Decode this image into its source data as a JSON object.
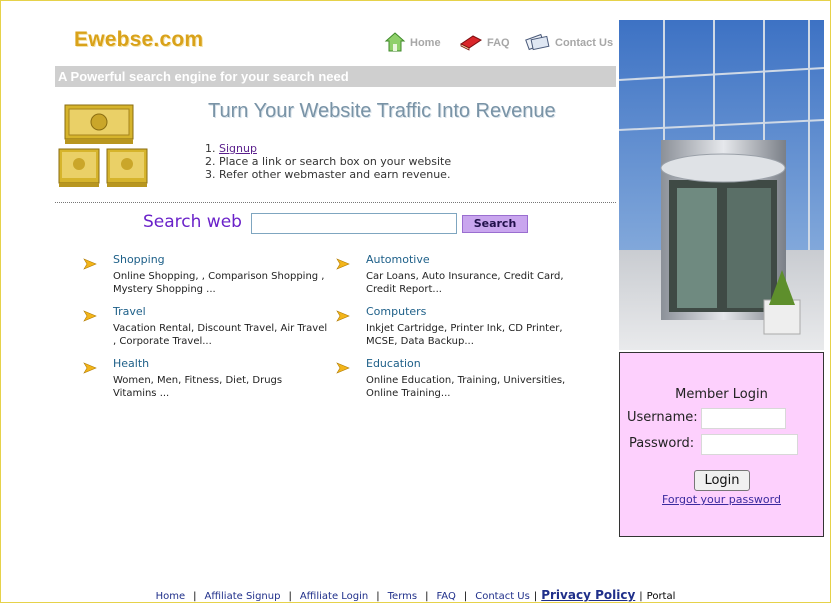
{
  "header": {
    "logo": "Ewebse.com",
    "nav": [
      {
        "label": "Home",
        "icon": "home-icon"
      },
      {
        "label": "FAQ",
        "icon": "book-icon"
      },
      {
        "label": "Contact Us",
        "icon": "cards-icon"
      }
    ],
    "tagline": "A Powerful search engine for your search need"
  },
  "promo": {
    "headline": "Turn Your Website Traffic Into Revenue",
    "steps": [
      {
        "prefix": "1. ",
        "text": "Signup"
      },
      {
        "prefix": "2. ",
        "text": "Place a link or search box on your website"
      },
      {
        "prefix": "3. ",
        "text": "Refer other webmaster and earn revenue."
      }
    ]
  },
  "search": {
    "label": "Search web",
    "button": "Search",
    "value": ""
  },
  "categories": [
    {
      "title": "Shopping",
      "desc": "Online Shopping, , Comparison Shopping , Mystery Shopping ..."
    },
    {
      "title": "Automotive",
      "desc": "Car Loans, Auto Insurance, Credit Card, Credit Report..."
    },
    {
      "title": "Travel",
      "desc": "Vacation Rental, Discount Travel, Air Travel , Corporate Travel..."
    },
    {
      "title": "Computers",
      "desc": "Inkjet Cartridge, Printer Ink, CD Printer, MCSE, Data Backup..."
    },
    {
      "title": "Health",
      "desc": "Women, Men, Fitness, Diet, Drugs Vitamins ..."
    },
    {
      "title": "Education",
      "desc": "Online Education, Training, Universities, Online Training..."
    }
  ],
  "login": {
    "title": "Member Login",
    "username_label": "Username:",
    "password_label": "Password:",
    "button": "Login",
    "forgot": "Forgot your password"
  },
  "footer": {
    "links": [
      "Home",
      "Affiliate Signup",
      "Affiliate Login",
      "Terms",
      "FAQ",
      "Contact Us"
    ],
    "privacy": "Privacy Policy",
    "portal": "Portal"
  },
  "colors": {
    "logo": "#d9a21a",
    "tagline_bg": "#cfcfcf",
    "search_label": "#6a22c9",
    "search_button": "#c9a6ee",
    "login_bg": "#fdd0fd",
    "category_title": "#1d5f88"
  }
}
